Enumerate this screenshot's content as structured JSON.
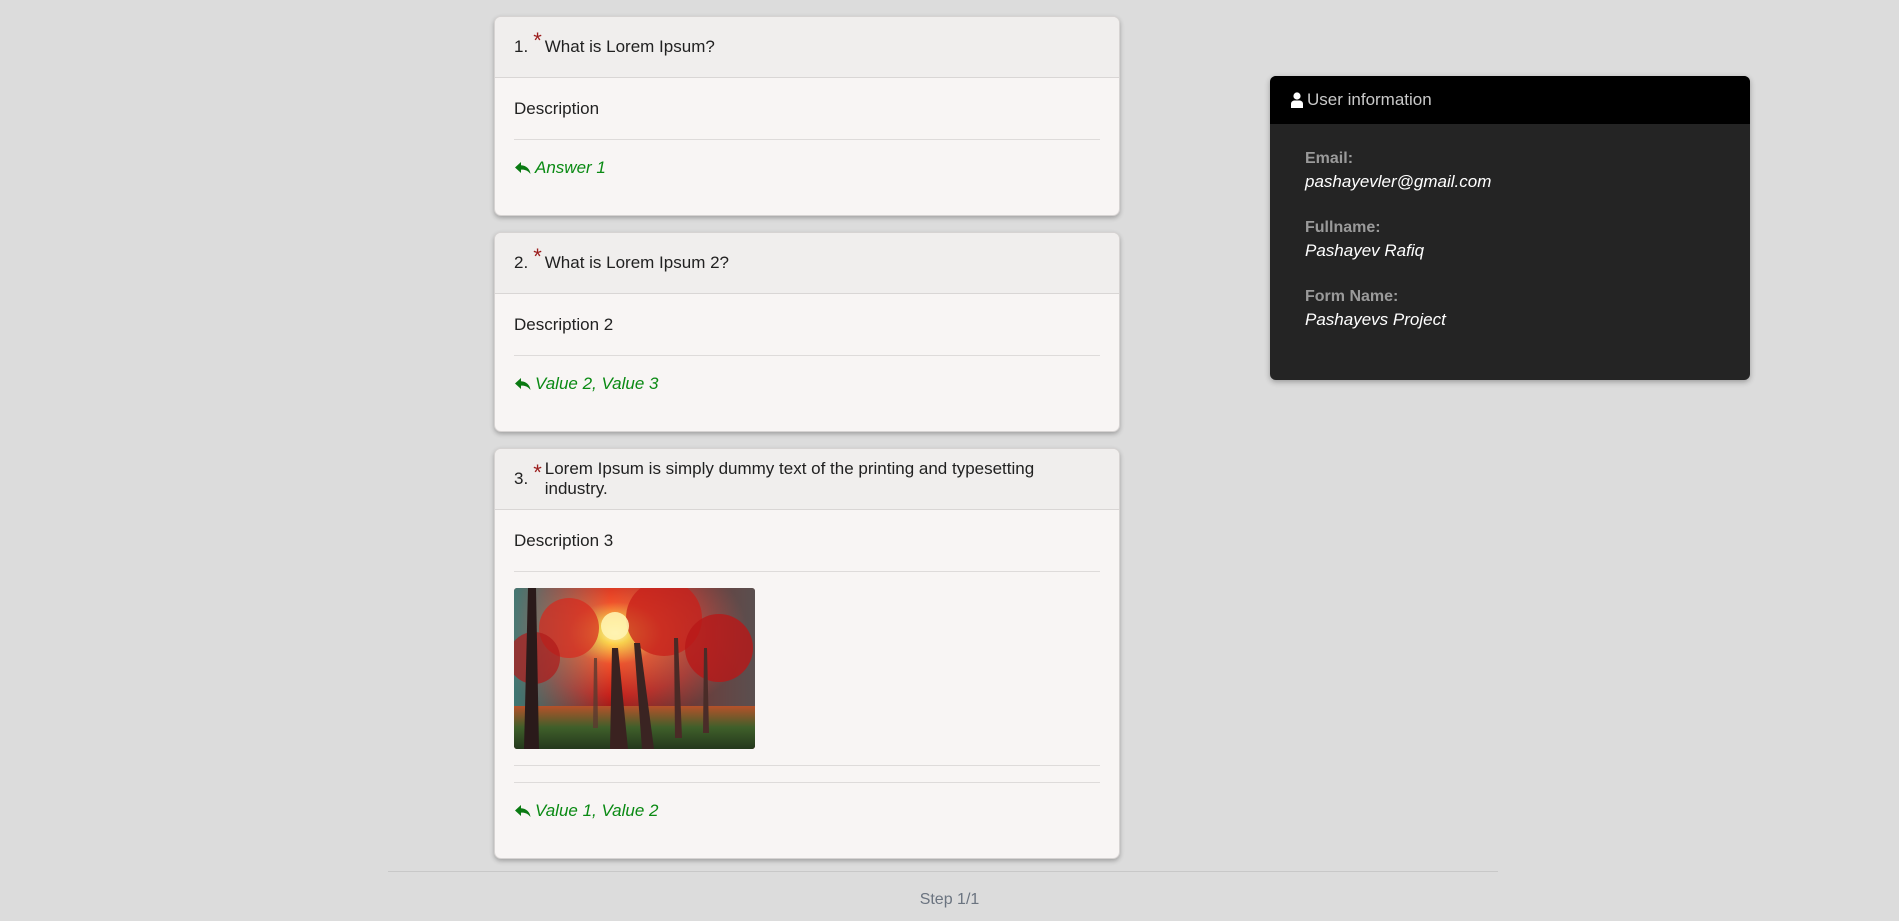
{
  "questions": [
    {
      "number": "1.",
      "required_mark": "*",
      "title": "What is Lorem Ipsum?",
      "description": "Description",
      "answer": "Answer 1"
    },
    {
      "number": "2.",
      "required_mark": "*",
      "title": "What is Lorem Ipsum 2?",
      "description": "Description 2",
      "answer": "Value 2, Value 3"
    },
    {
      "number": "3.",
      "required_mark": "*",
      "title": "Lorem Ipsum is simply dummy text of the printing and typesetting industry.",
      "description": "Description 3",
      "image": "autumn-forest-image",
      "answer": "Value 1, Value 2"
    }
  ],
  "user_info": {
    "title": "User information",
    "icon": "user-icon",
    "fields": [
      {
        "label": "Email:",
        "value": "pashayevler@gmail.com"
      },
      {
        "label": "Fullname:",
        "value": "Pashayev Rafiq"
      },
      {
        "label": "Form Name:",
        "value": "Pashayevs Project"
      }
    ]
  },
  "footer": {
    "step": "Step 1/1"
  },
  "colors": {
    "background": "#dcdcdc",
    "answer_green": "#0a8a13",
    "required_red": "#9b1c1c",
    "panel_dark": "#242424",
    "panel_header": "#000000"
  }
}
